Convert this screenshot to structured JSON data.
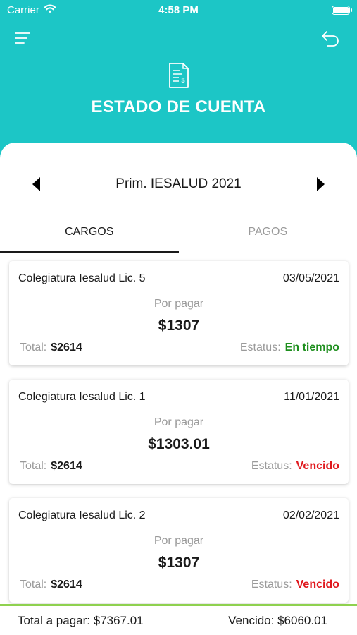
{
  "status_bar": {
    "carrier": "Carrier",
    "time": "4:58 PM"
  },
  "header": {
    "title": "ESTADO DE CUENTA"
  },
  "period": {
    "label": "Prim. IESALUD 2021"
  },
  "tabs": [
    {
      "label": "CARGOS",
      "active": true
    },
    {
      "label": "PAGOS",
      "active": false
    }
  ],
  "cards": [
    {
      "title": "Colegiatura Iesalud Lic. 5",
      "date": "03/05/2021",
      "pending_label": "Por pagar",
      "amount": "$1307",
      "total_label": "Total:",
      "total": "$2614",
      "status_label": "Estatus:",
      "status": "En tiempo",
      "status_color": "#1e8f1e"
    },
    {
      "title": "Colegiatura Iesalud Lic. 1",
      "date": "11/01/2021",
      "pending_label": "Por pagar",
      "amount": "$1303.01",
      "total_label": "Total:",
      "total": "$2614",
      "status_label": "Estatus:",
      "status": "Vencido",
      "status_color": "#e0191e"
    },
    {
      "title": "Colegiatura Iesalud Lic. 2",
      "date": "02/02/2021",
      "pending_label": "Por pagar",
      "amount": "$1307",
      "total_label": "Total:",
      "total": "$2614",
      "status_label": "Estatus:",
      "status": "Vencido",
      "status_color": "#e0191e"
    }
  ],
  "footer": {
    "total_label": "Total a pagar: $7367.01",
    "overdue_label": "Vencido: $6060.01"
  },
  "colors": {
    "header_bg": "#1cc6c6",
    "footer_accent": "#8fd14f"
  }
}
